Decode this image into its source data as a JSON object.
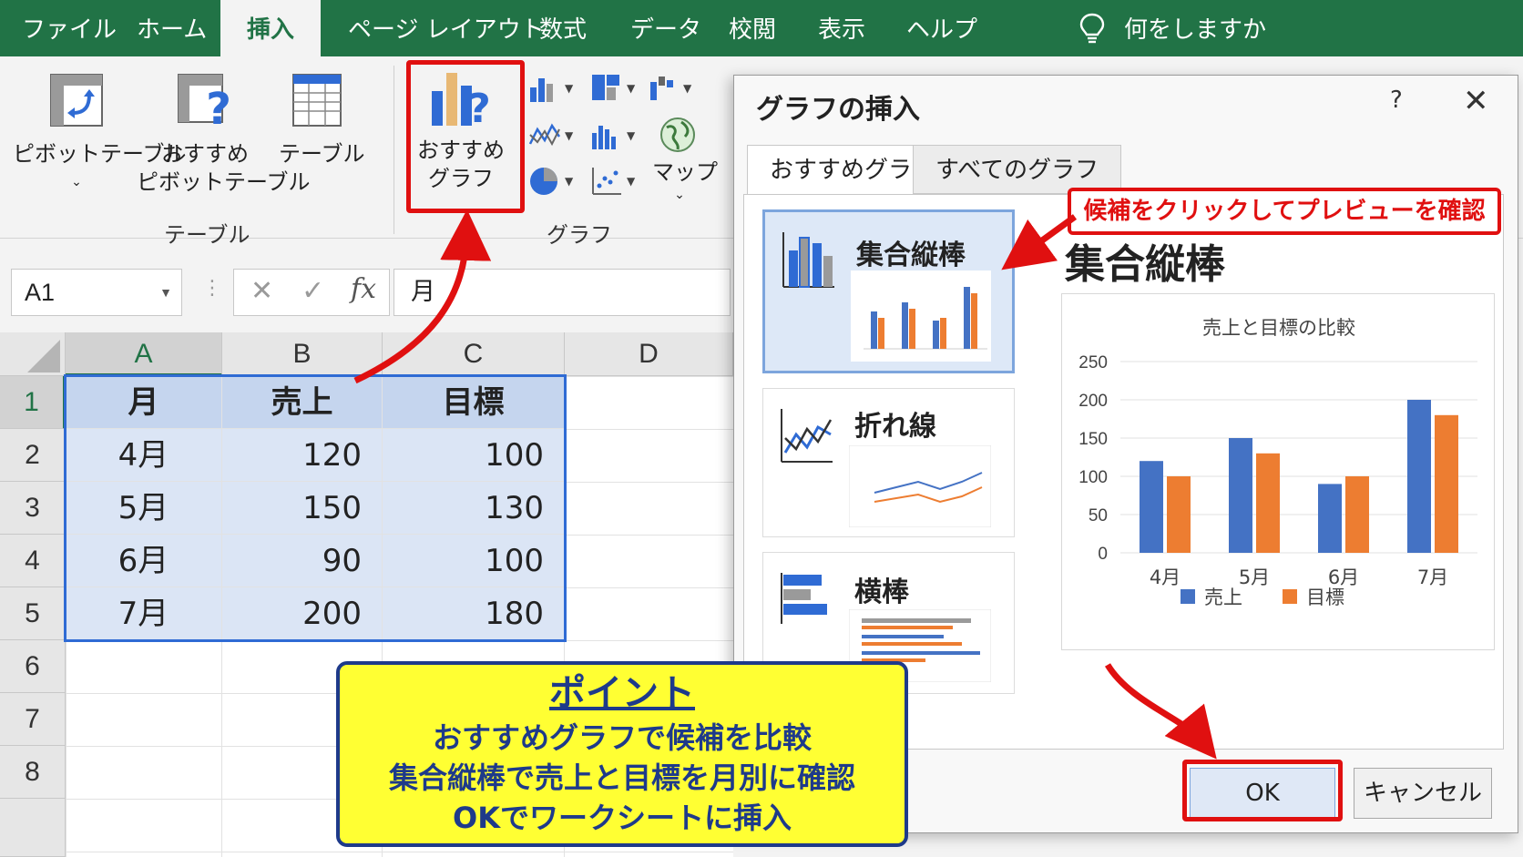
{
  "menu": {
    "tabs": [
      "ファイル",
      "ホーム",
      "挿入",
      "ページ レイアウト",
      "数式",
      "データ",
      "校閲",
      "表示",
      "ヘルプ"
    ],
    "active_tab": "挿入",
    "tell_me": "何をしますか"
  },
  "ribbon": {
    "pivot_table": "ピボットテーブル",
    "recommended_pivot_line1": "おすすめ",
    "recommended_pivot_line2": "ピボットテーブル",
    "table": "テーブル",
    "recommended_chart_line1": "おすすめ",
    "recommended_chart_line2": "グラフ",
    "map": "マップ",
    "group_table": "テーブル",
    "group_chart": "グラフ"
  },
  "formula_bar": {
    "name_box": "A1",
    "cancel_glyph": "✕",
    "enter_glyph": "✓",
    "fx": "fx",
    "content": "月"
  },
  "sheet": {
    "columns": [
      "A",
      "B",
      "C",
      "D"
    ],
    "rows": [
      "1",
      "2",
      "3",
      "4",
      "5",
      "6",
      "7",
      "8"
    ],
    "header": [
      "月",
      "売上",
      "目標"
    ],
    "data": [
      [
        "4月",
        "120",
        "100"
      ],
      [
        "5月",
        "150",
        "130"
      ],
      [
        "6月",
        "90",
        "100"
      ],
      [
        "7月",
        "200",
        "180"
      ]
    ]
  },
  "dialog": {
    "title": "グラフの挿入",
    "help": "?",
    "close": "✕",
    "tabs": [
      "おすすめグラフ",
      "すべてのグラフ"
    ],
    "cards": [
      "集合縦棒",
      "折れ線",
      "横棒"
    ],
    "preview_title": "集合縦棒",
    "ok": "OK",
    "cancel": "キャンセル"
  },
  "chart_data": {
    "type": "bar",
    "title": "売上と目標の比較",
    "categories": [
      "4月",
      "5月",
      "6月",
      "7月"
    ],
    "series": [
      {
        "name": "売上",
        "values": [
          120,
          150,
          90,
          200
        ],
        "color": "#4472c4"
      },
      {
        "name": "目標",
        "values": [
          100,
          130,
          100,
          180
        ],
        "color": "#ed7d31"
      }
    ],
    "ylim": [
      0,
      250
    ],
    "yticks": [
      0,
      50,
      100,
      150,
      200,
      250
    ],
    "grid": true,
    "legend": "bottom"
  },
  "annotations": {
    "callout": "候補をクリックしてプレビューを確認",
    "point_title": "ポイント",
    "point_lines": [
      "おすすめグラフで候補を比較",
      "集合縦棒で売上と目標を月別に確認",
      "OKでワークシートに挿入"
    ]
  },
  "colors": {
    "excel_green": "#217346",
    "highlight_red": "#e01010",
    "selection_fill": "#dbe5f5",
    "selection_border": "#2f6bd4",
    "point_yellow": "#ffff33",
    "point_navy": "#1e3a8a"
  }
}
